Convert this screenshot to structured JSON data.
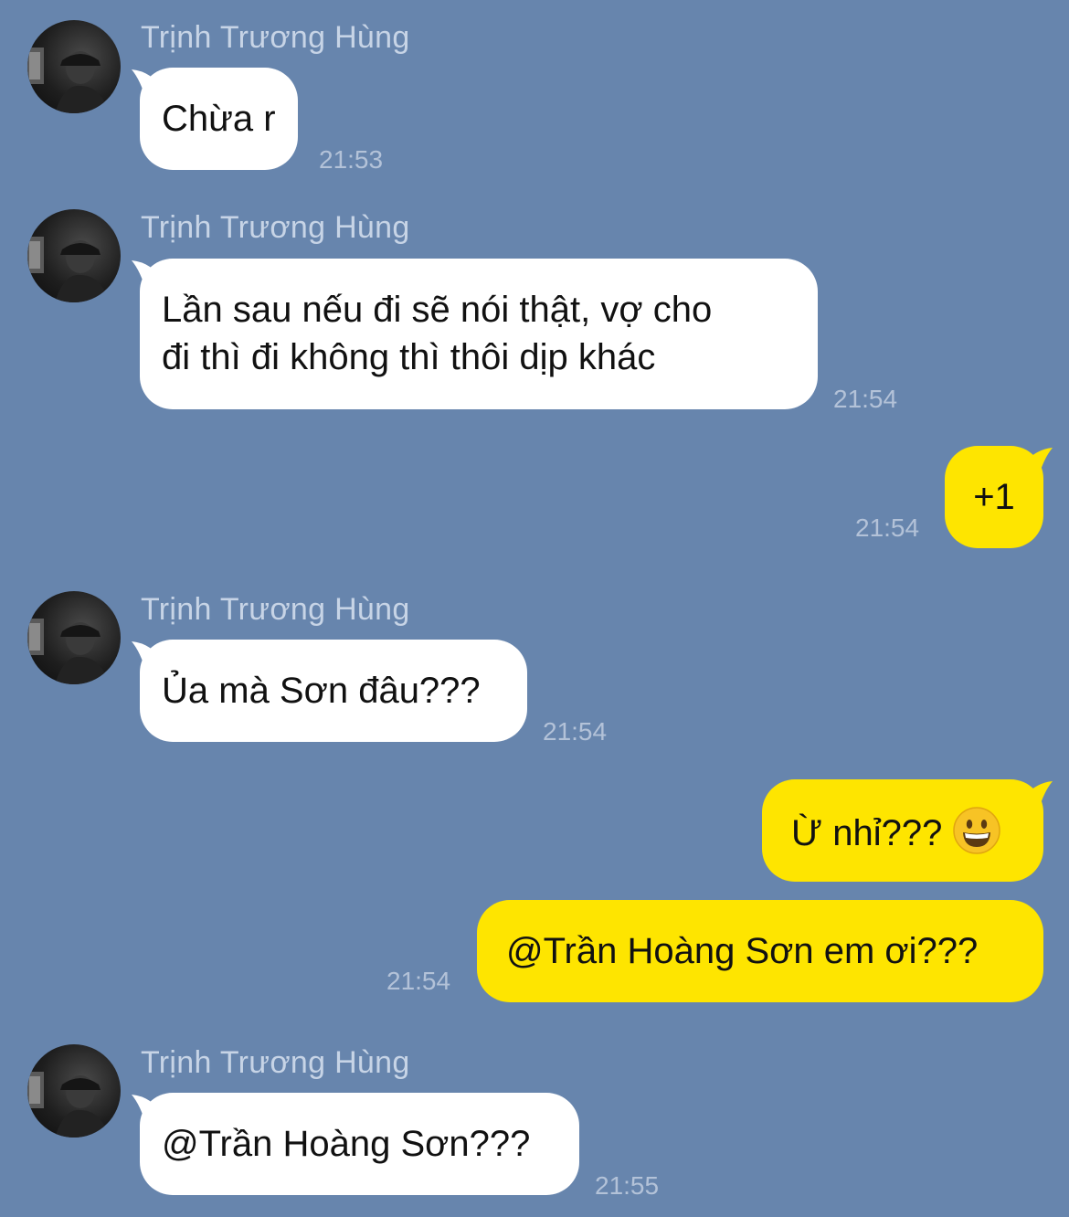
{
  "conversation": {
    "sender_name": "Trịnh Trương Hùng",
    "messages": [
      {
        "from": "incoming",
        "text": "Chừa r",
        "time": "21:53"
      },
      {
        "from": "incoming",
        "lines": [
          "Lần sau nếu đi sẽ nói thật, vợ cho",
          "đi thì đi không thì thôi dịp khác"
        ],
        "time": "21:54"
      },
      {
        "from": "outgoing",
        "text": "+1",
        "time": "21:54"
      },
      {
        "from": "incoming",
        "text": "Ủa mà Sơn đâu???",
        "time": "21:54"
      },
      {
        "from": "outgoing",
        "text": "Ừ nhỉ???",
        "emoji": "grinning-face-emoji"
      },
      {
        "from": "outgoing",
        "text": "@Trần Hoàng Sơn em ơi???",
        "time": "21:54"
      },
      {
        "from": "incoming",
        "text": "@Trần Hoàng Sơn???",
        "time": "21:55"
      }
    ]
  },
  "colors": {
    "background": "#6785ad",
    "incoming_bubble": "#ffffff",
    "outgoing_bubble": "#fee500",
    "sender_name": "#c7d4e6",
    "timestamp": "#b3c2d8"
  }
}
